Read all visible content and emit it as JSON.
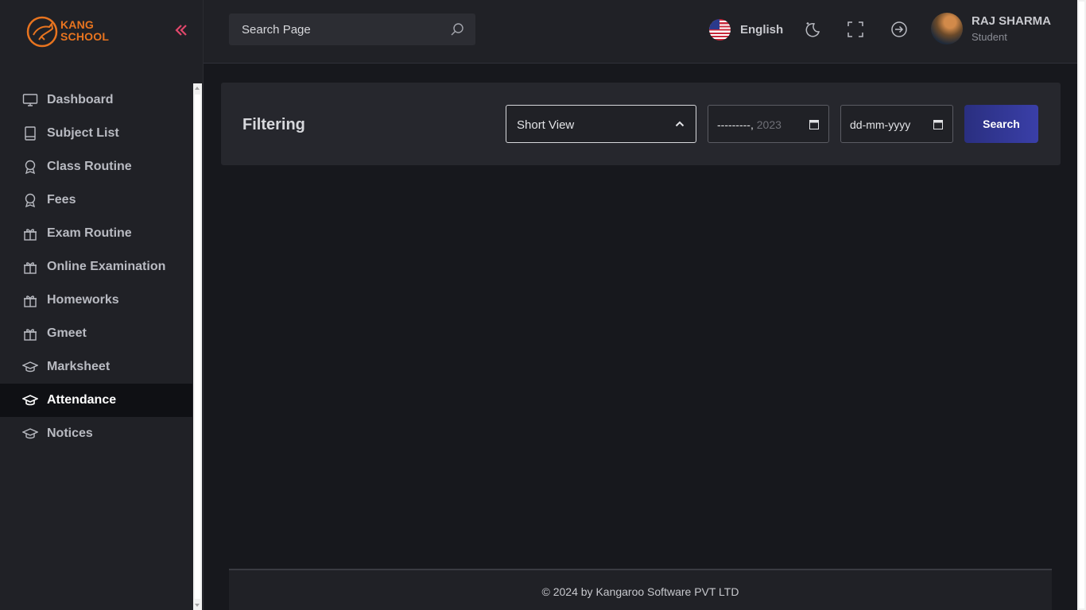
{
  "brand": {
    "logo_line1": "KANG",
    "logo_line2": "SCHOOL",
    "accent": "#e8741f"
  },
  "sidebar": {
    "items": [
      {
        "label": "Dashboard",
        "icon": "monitor-icon",
        "active": false
      },
      {
        "label": "Subject List",
        "icon": "book-icon",
        "active": false
      },
      {
        "label": "Class Routine",
        "icon": "award-icon",
        "active": false
      },
      {
        "label": "Fees",
        "icon": "award-icon",
        "active": false
      },
      {
        "label": "Exam Routine",
        "icon": "gift-icon",
        "active": false
      },
      {
        "label": "Online Examination",
        "icon": "gift-icon",
        "active": false
      },
      {
        "label": "Homeworks",
        "icon": "gift-icon",
        "active": false
      },
      {
        "label": "Gmeet",
        "icon": "gift-icon",
        "active": false
      },
      {
        "label": "Marksheet",
        "icon": "graduation-cap-icon",
        "active": false
      },
      {
        "label": "Attendance",
        "icon": "graduation-cap-icon",
        "active": true
      },
      {
        "label": "Notices",
        "icon": "graduation-cap-icon",
        "active": false
      }
    ]
  },
  "header": {
    "search_placeholder": "Search Page",
    "language": "English",
    "user_name": "RAJ SHARMA",
    "user_role": "Student"
  },
  "filter": {
    "title": "Filtering",
    "view_select": "Short View",
    "month_prefix": "---------,",
    "month_year": "2023",
    "date_placeholder": "dd-mm-yyyy",
    "search_button": "Search"
  },
  "footer": {
    "text": "© 2024 by Kangaroo Software PVT LTD"
  }
}
